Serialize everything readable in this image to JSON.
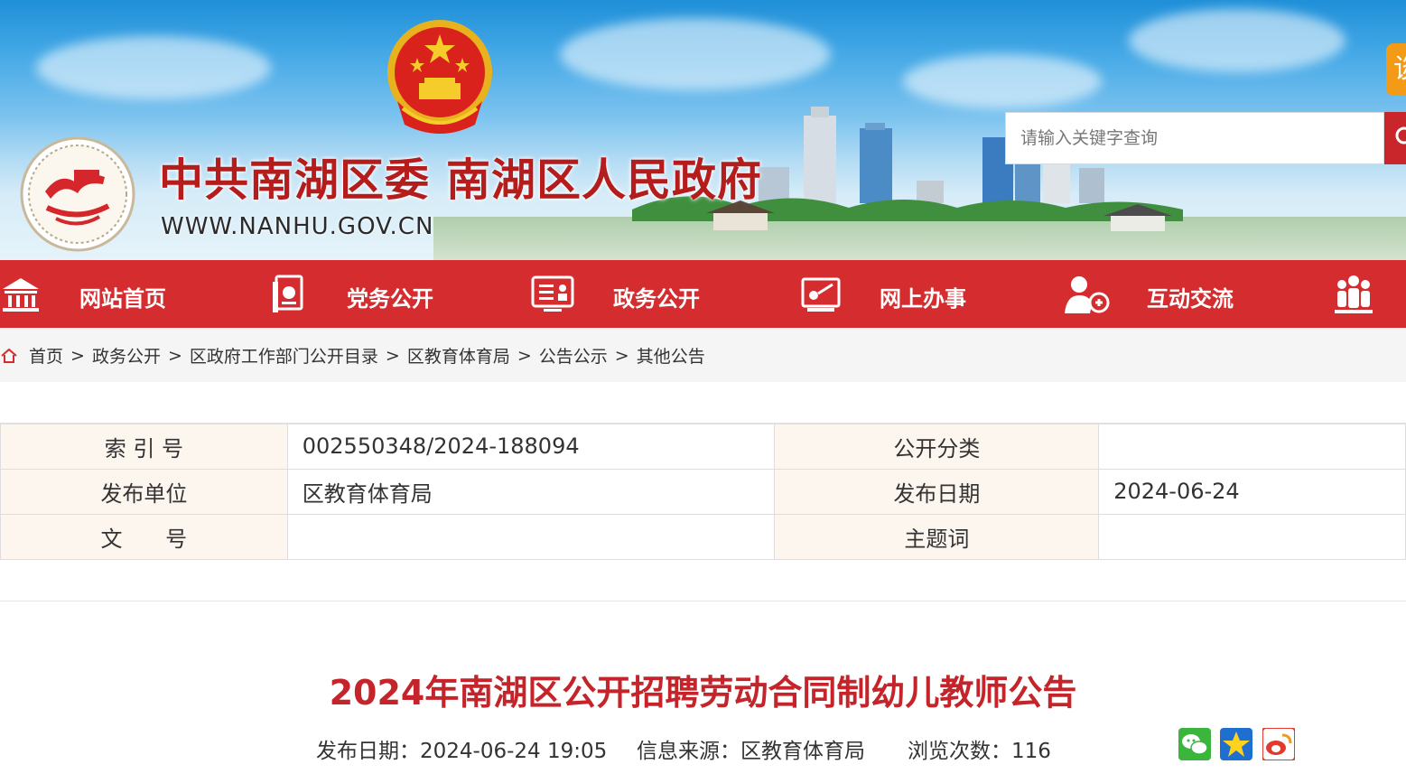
{
  "header": {
    "site_title": "中共南湖区委 南湖区人民政府",
    "site_url": "WWW.NANHU.GOV.CN",
    "search_placeholder": "请输入关键字查询",
    "side_tab_text": "谈"
  },
  "nav": {
    "items": [
      {
        "label": "网站首页",
        "icon": "home-building-icon"
      },
      {
        "label": "党务公开",
        "icon": "party-book-icon"
      },
      {
        "label": "政务公开",
        "icon": "gov-info-icon"
      },
      {
        "label": "网上办事",
        "icon": "online-service-icon"
      },
      {
        "label": "互动交流",
        "icon": "interaction-person-icon"
      },
      {
        "label": "",
        "icon": "people-group-icon"
      }
    ]
  },
  "breadcrumb": [
    "首页",
    "政务公开",
    "区政府工作部门公开目录",
    "区教育体育局",
    "公告公示",
    "其他公告"
  ],
  "info": {
    "index_label": "索 引 号",
    "index_value": "002550348/2024-188094",
    "category_label": "公开分类",
    "category_value": "",
    "publisher_label": "发布单位",
    "publisher_value": "区教育体育局",
    "date_label": "发布日期",
    "date_value": "2024-06-24",
    "doc_no_label": "文 号",
    "doc_no_value": "",
    "keyword_label": "主题词",
    "keyword_value": ""
  },
  "article": {
    "title": "2024年南湖区公开招聘劳动合同制幼儿教师公告",
    "publish_date": "发布日期：2024-06-24 19:05",
    "source": "信息来源：区教育体育局",
    "views": "浏览次数：116"
  },
  "share": [
    "wechat-share-icon",
    "favorite-star-icon",
    "weibo-share-icon"
  ],
  "colors": {
    "nav_red": "#d52c2f",
    "title_red": "#c4242a",
    "label_bg": "#fdf6ef"
  }
}
